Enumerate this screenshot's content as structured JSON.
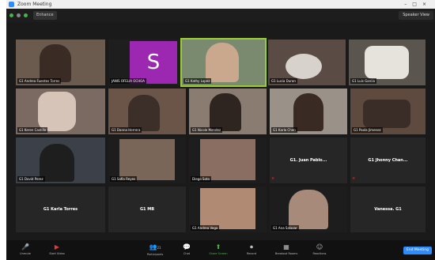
{
  "window": {
    "title": "Zoom Meeting"
  },
  "top_bar": {
    "info_label": "Enhance",
    "speaker_view_label": "Speaker View"
  },
  "tiles": [
    {
      "label": "G1 Andrea Fuentes Torres",
      "muted": true
    },
    {
      "label": "JANIS OFELIA OCHOA",
      "muted": true,
      "initial": "S"
    },
    {
      "label": "G1 Kathy Lopez",
      "muted": true
    },
    {
      "label": "G1 Lucia Duran",
      "muted": true
    },
    {
      "label": "G1 Luis Garcia",
      "muted": true
    },
    {
      "label": "G1 Keren Castillo",
      "muted": true
    },
    {
      "label": "G1 Danna Herrera",
      "muted": true
    },
    {
      "label": "G1 Nicole Mendez",
      "muted": true
    },
    {
      "label": "G1 Karla Chen",
      "muted": true
    },
    {
      "label": "G1 Paola Jimenez",
      "muted": true
    },
    {
      "label": "G1 David Perez",
      "muted": true
    },
    {
      "label": "G1 Sofia Reyes",
      "muted": true
    },
    {
      "label": "Diego Soto",
      "muted": false
    },
    {
      "label": "G1. Juan Pablo...",
      "muted": true,
      "name_only": true
    },
    {
      "label": "G1 Jhonny Chan...",
      "muted": true,
      "name_only": true
    },
    {
      "label": "G1 Karla Torres",
      "muted": false,
      "name_only": true
    },
    {
      "label": "G1 MB",
      "muted": false,
      "name_only": true
    },
    {
      "label": "G1 Andrea Vega",
      "muted": true
    },
    {
      "label": "G1 Ana Salazar",
      "muted": true
    },
    {
      "label": "Vanessa. G1",
      "muted": false,
      "name_only": true
    }
  ],
  "toolbar": {
    "unmute": "Unmute",
    "start_video": "Start Video",
    "participants": "Participants",
    "participants_count": "21",
    "chat": "Chat",
    "share_screen": "Share Screen",
    "record": "Record",
    "breakout_rooms": "Breakout Rooms",
    "reactions": "Reactions",
    "end": "End Meeting"
  },
  "colors": {
    "accent": "#2d8cff",
    "share": "#4caf50",
    "highlight": "#9acd32",
    "muted": "#e53935",
    "purple_tile": "#9c27b0"
  }
}
